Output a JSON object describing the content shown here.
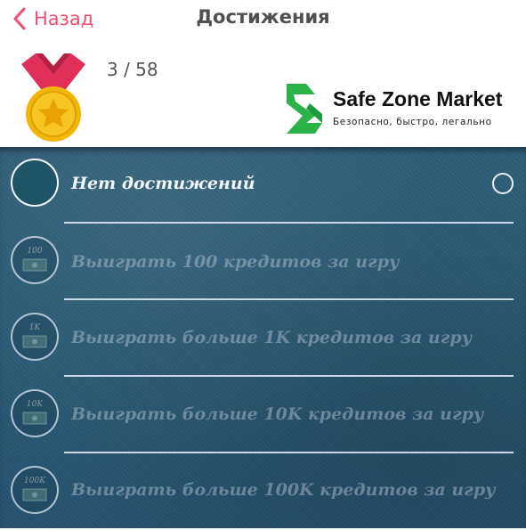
{
  "header": {
    "back_label": "Назад",
    "title": "Достижения",
    "progress": "3 / 58"
  },
  "logo": {
    "name": "Safe Zone Market",
    "tagline": "Безопасно, быстро, легально",
    "color": "#2bb34a"
  },
  "achievements": [
    {
      "label": "Нет достижений",
      "active": true,
      "badge": ""
    },
    {
      "label": "Выиграть 100 кредитов за игру",
      "active": false,
      "badge": "100"
    },
    {
      "label": "Выиграть больше 1K кредитов за игру",
      "active": false,
      "badge": "1K"
    },
    {
      "label": "Выиграть больше 10K кредитов за игру",
      "active": false,
      "badge": "10K"
    },
    {
      "label": "Выиграть больше 100K кредитов за игру",
      "active": false,
      "badge": "100K"
    }
  ],
  "colors": {
    "accent": "#f0506e",
    "list_background": "#2a5d77",
    "medal_gold": "#f2b705",
    "medal_ribbon": "#e0305a"
  }
}
